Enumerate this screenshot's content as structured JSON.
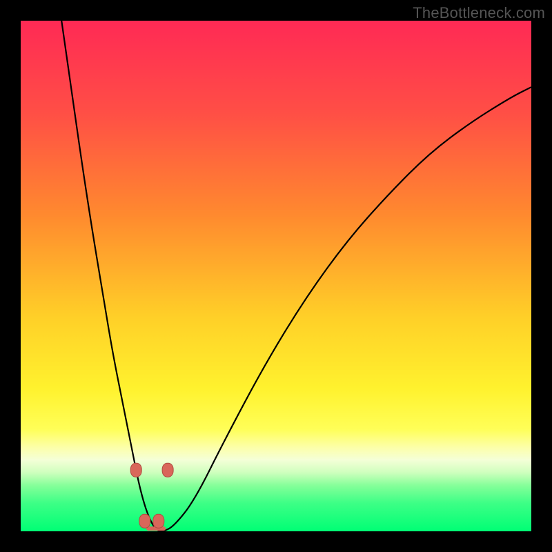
{
  "watermark": "TheBottleneck.com",
  "colors": {
    "frame_bg": "#000000",
    "curve": "#000000",
    "marker_fill": "#d9675a",
    "marker_stroke": "#b04c40",
    "gradient_stops": [
      {
        "offset": 0.0,
        "color": "#ff2a55"
      },
      {
        "offset": 0.18,
        "color": "#ff4f46"
      },
      {
        "offset": 0.38,
        "color": "#ff8a2f"
      },
      {
        "offset": 0.58,
        "color": "#ffd028"
      },
      {
        "offset": 0.72,
        "color": "#fff22e"
      },
      {
        "offset": 0.8,
        "color": "#ffff58"
      },
      {
        "offset": 0.835,
        "color": "#fdffa8"
      },
      {
        "offset": 0.86,
        "color": "#f5ffd8"
      },
      {
        "offset": 0.885,
        "color": "#cfffbe"
      },
      {
        "offset": 0.91,
        "color": "#86ff9a"
      },
      {
        "offset": 0.945,
        "color": "#3dff86"
      },
      {
        "offset": 1.0,
        "color": "#00ff75"
      }
    ]
  },
  "chart_data": {
    "type": "line",
    "title": "",
    "xlabel": "",
    "ylabel": "",
    "x_range": [
      0,
      100
    ],
    "y_range": [
      0,
      100
    ],
    "series": [
      {
        "name": "bottleneck-curve",
        "x": [
          8,
          10,
          12,
          14,
          16,
          18,
          20,
          22,
          23,
          24,
          25,
          26,
          27,
          28,
          30,
          34,
          40,
          48,
          56,
          64,
          72,
          80,
          88,
          96,
          100
        ],
        "values": [
          100,
          86,
          72,
          59,
          47,
          35,
          25,
          15,
          10,
          6,
          3,
          1,
          0,
          0,
          1,
          6,
          18,
          33,
          46,
          57,
          66,
          74,
          80,
          85,
          87
        ]
      }
    ],
    "markers": {
      "name": "highlight-points",
      "x": [
        22.6,
        24.3,
        27.0,
        28.8
      ],
      "values": [
        12.0,
        2.0,
        2.0,
        12.0
      ]
    },
    "flat_segment": {
      "x_start": 25.0,
      "x_end": 28.0,
      "value": 0
    }
  }
}
